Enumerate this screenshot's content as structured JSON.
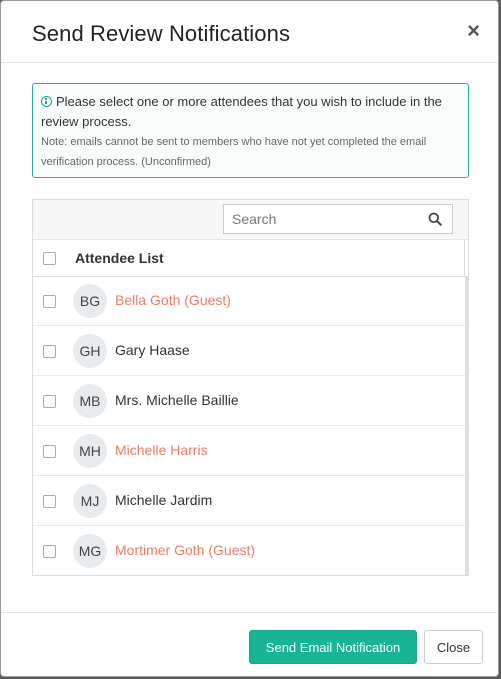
{
  "modal": {
    "title": "Send Review Notifications",
    "close_glyph": "×"
  },
  "info": {
    "message": "Please select one or more attendees that you wish to include in the review process.",
    "note": "Note: emails cannot be sent to members who have not yet completed the email verification process. (Unconfirmed)",
    "icon": "info-circle-icon"
  },
  "search": {
    "placeholder": "Search",
    "value": "",
    "icon": "search-icon"
  },
  "list": {
    "header": "Attendee List",
    "attendees": [
      {
        "initials": "BG",
        "name": "Bella Goth (Guest)",
        "unconfirmed": true
      },
      {
        "initials": "GH",
        "name": "Gary Haase",
        "unconfirmed": false
      },
      {
        "initials": "MB",
        "name": "Mrs. Michelle Baillie",
        "unconfirmed": false
      },
      {
        "initials": "MH",
        "name": "Michelle Harris",
        "unconfirmed": true
      },
      {
        "initials": "MJ",
        "name": "Michelle Jardim",
        "unconfirmed": false
      },
      {
        "initials": "MG",
        "name": "Mortimer Goth (Guest)",
        "unconfirmed": true
      }
    ]
  },
  "footer": {
    "send_label": "Send Email Notification",
    "close_label": "Close"
  },
  "colors": {
    "accent": "#17b596",
    "unconfirmed_text": "#f07a64"
  }
}
